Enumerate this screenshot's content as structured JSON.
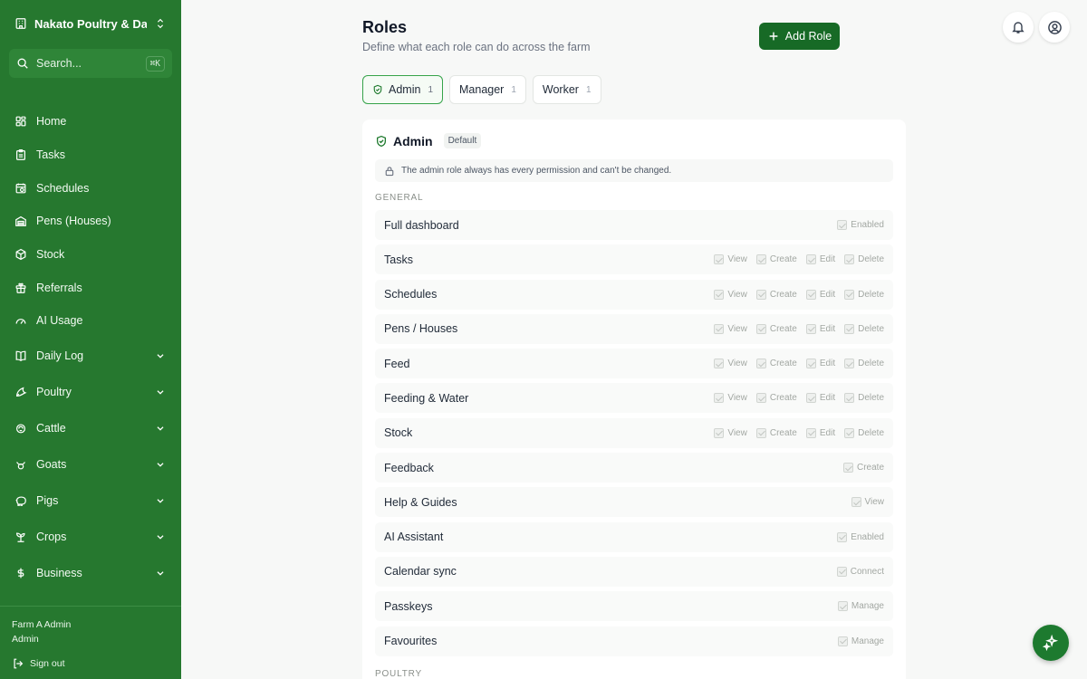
{
  "sidebar": {
    "farm_name": "Nakato Poultry & Da...",
    "search_placeholder": "Search...",
    "search_shortcut": "⌘K",
    "items": [
      {
        "label": "Home",
        "icon": "home-grid-icon"
      },
      {
        "label": "Tasks",
        "icon": "clipboard-icon"
      },
      {
        "label": "Schedules",
        "icon": "calendar-clock-icon"
      },
      {
        "label": "Pens (Houses)",
        "icon": "warehouse-icon"
      },
      {
        "label": "Stock",
        "icon": "box-icon"
      },
      {
        "label": "Referrals",
        "icon": "gift-icon"
      },
      {
        "label": "AI Usage",
        "icon": "gauge-icon"
      }
    ],
    "groups": [
      {
        "label": "Daily Log",
        "icon": "book-icon"
      },
      {
        "label": "Poultry",
        "icon": "bird-icon"
      },
      {
        "label": "Cattle",
        "icon": "cattle-icon"
      },
      {
        "label": "Goats",
        "icon": "goat-icon"
      },
      {
        "label": "Pigs",
        "icon": "pig-icon"
      },
      {
        "label": "Crops",
        "icon": "sprout-icon"
      },
      {
        "label": "Business",
        "icon": "dollar-icon"
      }
    ],
    "footer": {
      "user_name": "Farm A Admin",
      "user_role": "Admin",
      "sign_out": "Sign out"
    }
  },
  "header": {
    "title": "Roles",
    "subtitle": "Define what each role can do across the farm",
    "add_button": "Add Role"
  },
  "tabs": [
    {
      "label": "Admin",
      "count": "1",
      "active": true
    },
    {
      "label": "Manager",
      "count": "1",
      "active": false
    },
    {
      "label": "Worker",
      "count": "1",
      "active": false
    }
  ],
  "role_card": {
    "title": "Admin",
    "badge": "Default",
    "notice": "The admin role always has every permission and can't be changed.",
    "sections": [
      "GENERAL",
      "POULTRY"
    ],
    "rows": [
      {
        "name": "Full dashboard",
        "perms": [
          "Enabled"
        ]
      },
      {
        "name": "Tasks",
        "perms": [
          "View",
          "Create",
          "Edit",
          "Delete"
        ]
      },
      {
        "name": "Schedules",
        "perms": [
          "View",
          "Create",
          "Edit",
          "Delete"
        ]
      },
      {
        "name": "Pens / Houses",
        "perms": [
          "View",
          "Create",
          "Edit",
          "Delete"
        ]
      },
      {
        "name": "Feed",
        "perms": [
          "View",
          "Create",
          "Edit",
          "Delete"
        ]
      },
      {
        "name": "Feeding & Water",
        "perms": [
          "View",
          "Create",
          "Edit",
          "Delete"
        ]
      },
      {
        "name": "Stock",
        "perms": [
          "View",
          "Create",
          "Edit",
          "Delete"
        ]
      },
      {
        "name": "Feedback",
        "perms": [
          "Create"
        ]
      },
      {
        "name": "Help & Guides",
        "perms": [
          "View"
        ]
      },
      {
        "name": "AI Assistant",
        "perms": [
          "Enabled"
        ]
      },
      {
        "name": "Calendar sync",
        "perms": [
          "Connect"
        ]
      },
      {
        "name": "Passkeys",
        "perms": [
          "Manage"
        ]
      },
      {
        "name": "Favourites",
        "perms": [
          "Manage"
        ]
      }
    ]
  },
  "colors": {
    "sidebar": "#26782f",
    "accent": "#176a26",
    "active_tab_border": "#36a34a"
  }
}
